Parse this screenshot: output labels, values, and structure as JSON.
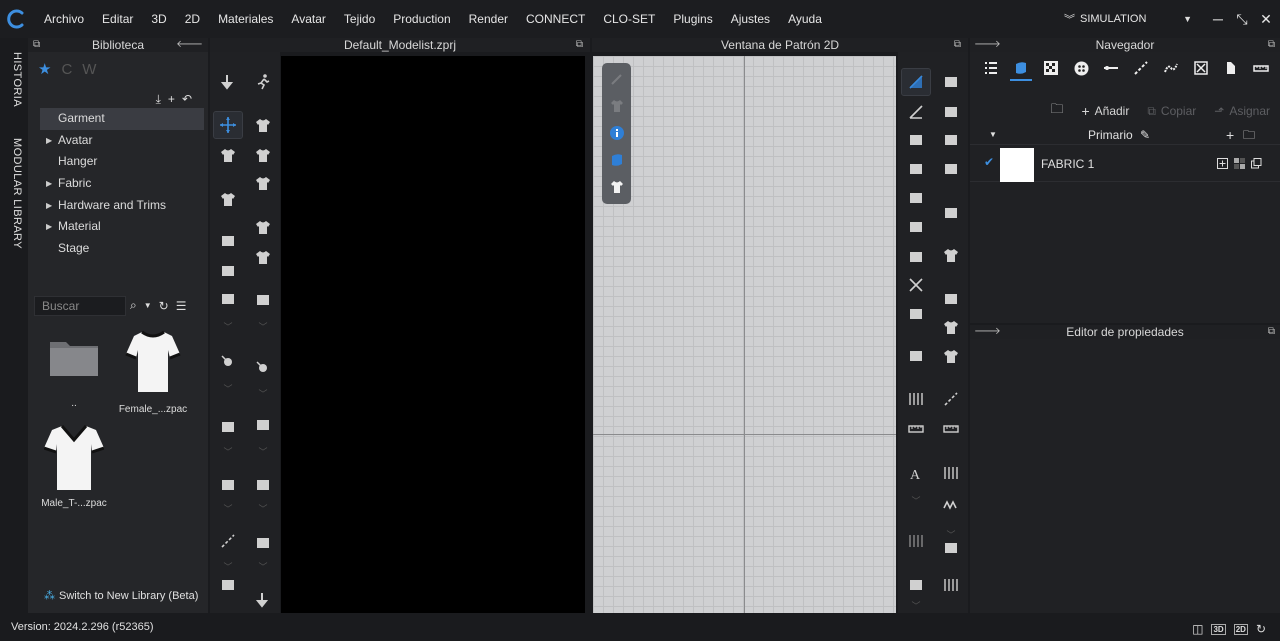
{
  "menubar": {
    "items": [
      "Archivo",
      "Editar",
      "3D",
      "2D",
      "Materiales",
      "Avatar",
      "Tejido",
      "Production",
      "Render",
      "CONNECT",
      "CLO-SET",
      "Plugins",
      "Ajustes",
      "Ayuda"
    ],
    "mode": "SIMULATION",
    "accent": "#3d8fe0"
  },
  "side_tabs": [
    "HISTORIA",
    "MODULAR LIBRARY"
  ],
  "library": {
    "title": "Biblioteca",
    "tree": [
      {
        "label": "Garment",
        "expandable": false,
        "selected": true
      },
      {
        "label": "Avatar",
        "expandable": true,
        "selected": false
      },
      {
        "label": "Hanger",
        "expandable": false,
        "selected": false
      },
      {
        "label": "Fabric",
        "expandable": true,
        "selected": false
      },
      {
        "label": "Hardware and Trims",
        "expandable": true,
        "selected": false
      },
      {
        "label": "Material",
        "expandable": true,
        "selected": false
      },
      {
        "label": "Stage",
        "expandable": false,
        "selected": false
      }
    ],
    "search_placeholder": "Buscar",
    "files": [
      {
        "name": "..",
        "icon": "folder-icon"
      },
      {
        "name": "Female_...zpac",
        "icon": "female-tshirt-icon"
      },
      {
        "name": "Male_T-...zpac",
        "icon": "male-tshirt-icon"
      }
    ],
    "switch_label": "Switch to New Library (Beta)"
  },
  "view3d": {
    "title": "Default_Modelist.zprj"
  },
  "view2d": {
    "title": "Ventana de Patrón 2D"
  },
  "navigator": {
    "title": "Navegador",
    "add_label": "Añadir",
    "copy_label": "Copiar",
    "assign_label": "Asignar",
    "group_label": "Primario",
    "fabric_name": "FABRIC 1"
  },
  "properties": {
    "title": "Editor de propiedades"
  },
  "status": {
    "version": "Version: 2024.2.296 (r52365)"
  }
}
